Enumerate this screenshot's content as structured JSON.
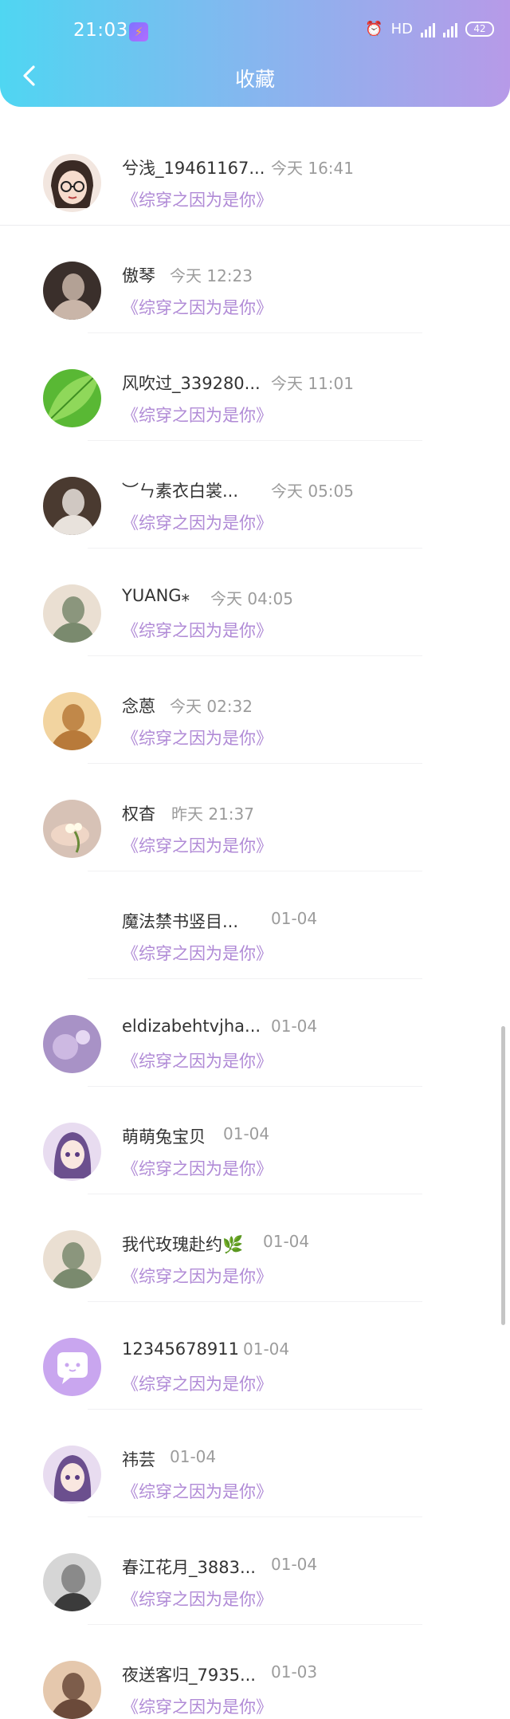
{
  "status_bar": {
    "time": "21:03",
    "hd_label": "HD",
    "battery": "42"
  },
  "header": {
    "title": "收藏"
  },
  "favorites": [
    {
      "name": "兮浅_19461167...",
      "time": "今天 16:41",
      "book": "《综穿之因为是你》",
      "avatar": "cartoon-girl-glasses-avatar"
    },
    {
      "name": "傲琴",
      "time": "今天 12:23",
      "book": "《综穿之因为是你》",
      "avatar": "photo-avatar"
    },
    {
      "name": "风吹过_339280...",
      "time": "今天 11:01",
      "book": "《综穿之因为是你》",
      "avatar": "green-leaf-avatar"
    },
    {
      "name": "︶ㄣ素衣白裳...",
      "time": "今天 05:05",
      "book": "《综穿之因为是你》",
      "avatar": "photo-avatar"
    },
    {
      "name": "YUANG⁎",
      "time": "今天 04:05",
      "book": "《综穿之因为是你》",
      "avatar": "photo-avatar"
    },
    {
      "name": "念蒽",
      "time": "今天 02:32",
      "book": "《综穿之因为是你》",
      "avatar": "photo-avatar"
    },
    {
      "name": "权杳",
      "time": "昨天 21:37",
      "book": "《综穿之因为是你》",
      "avatar": "flower-hand-avatar"
    },
    {
      "name": "魔法禁书竖目...",
      "time": "01-04",
      "book": "《综穿之因为是你》",
      "avatar": "blank-avatar"
    },
    {
      "name": "eldizabehtvjha...",
      "time": "01-04",
      "book": "《综穿之因为是你》",
      "avatar": "purple-photo-avatar"
    },
    {
      "name": "萌萌兔宝贝",
      "time": "01-04",
      "book": "《综穿之因为是你》",
      "avatar": "anime-girl-avatar"
    },
    {
      "name": "我代玫瑰赴约🌿",
      "time": "01-04",
      "book": "《综穿之因为是你》",
      "avatar": "photo-avatar"
    },
    {
      "name": "12345678911",
      "time": "01-04",
      "book": "《综穿之因为是你》",
      "avatar": "default-chat-avatar"
    },
    {
      "name": "祎芸",
      "time": "01-04",
      "book": "《综穿之因为是你》",
      "avatar": "anime-girl-avatar"
    },
    {
      "name": "春江花月_3883...",
      "time": "01-04",
      "book": "《综穿之因为是你》",
      "avatar": "bw-photo-avatar"
    },
    {
      "name": "夜送客归_7935...",
      "time": "01-03",
      "book": "《综穿之因为是你》",
      "avatar": "photo-avatar"
    }
  ]
}
